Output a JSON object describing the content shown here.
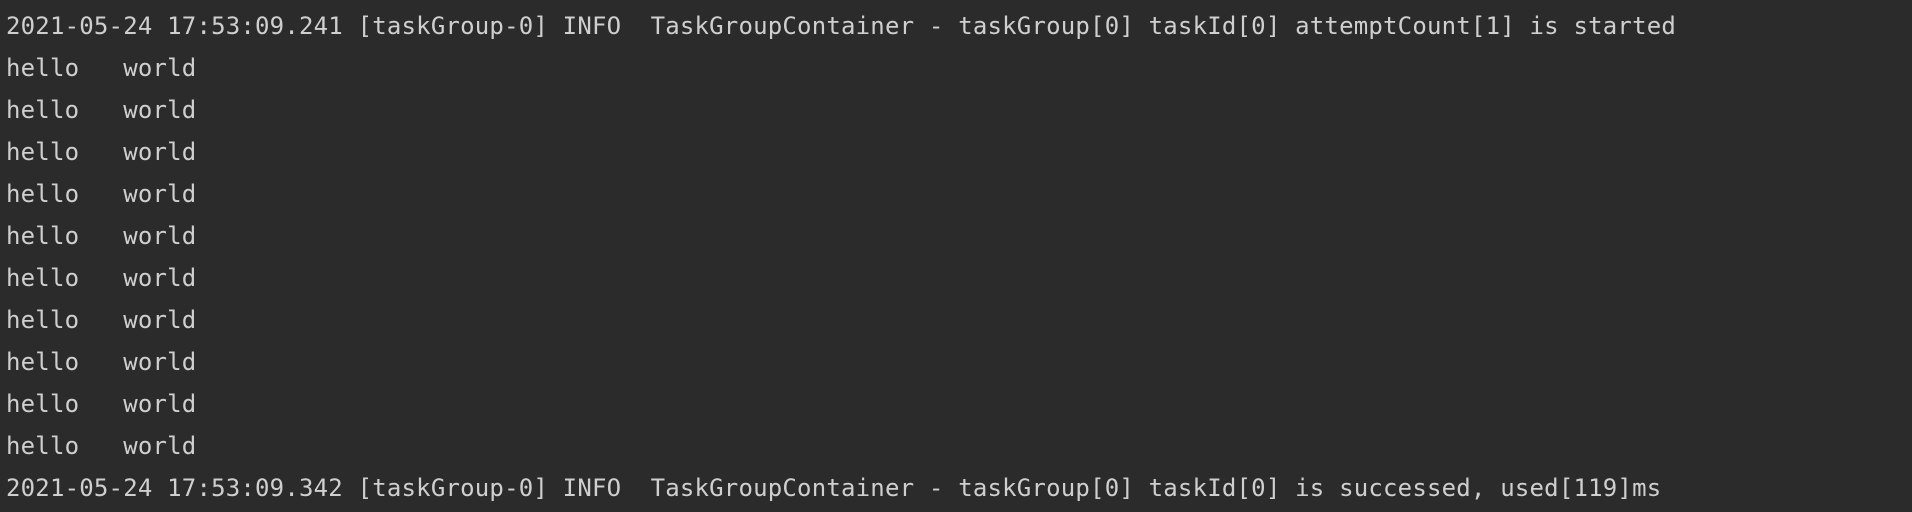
{
  "console": {
    "lines": [
      "2021-05-24 17:53:09.241 [taskGroup-0] INFO  TaskGroupContainer - taskGroup[0] taskId[0] attemptCount[1] is started",
      "hello   world",
      "hello   world",
      "hello   world",
      "hello   world",
      "hello   world",
      "hello   world",
      "hello   world",
      "hello   world",
      "hello   world",
      "hello   world",
      "2021-05-24 17:53:09.342 [taskGroup-0] INFO  TaskGroupContainer - taskGroup[0] taskId[0] is successed, used[119]ms"
    ]
  },
  "colors": {
    "background": "#2b2b2b",
    "text": "#cfcfcf"
  }
}
